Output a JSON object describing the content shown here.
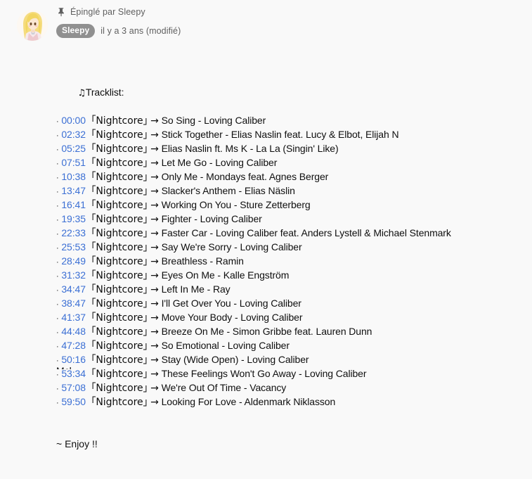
{
  "comment": {
    "pinned_label": "Épinglé par Sleepy",
    "pin_icon": "pin-icon",
    "author_name": "Sleepy",
    "timestamp": "il y a 3 ans (modifié)",
    "avatar_alt": "anime-girl-avatar",
    "heading": "♫ Tracklist:",
    "heading_note": "♫",
    "heading_text": "Tracklist:",
    "bullet": "·",
    "bracket_open": "｢",
    "bracket_close": "｣",
    "bracket_label": "Nightcore",
    "arrow": "→",
    "footer": "~ Enjoy !!",
    "footer_clipped": "Mcl"
  },
  "tracklist": [
    {
      "time": "00:00",
      "title": "So Sing - Loving Caliber"
    },
    {
      "time": "02:32",
      "title": "Stick Together - Elias Naslin feat. Lucy & Elbot, Elijah N"
    },
    {
      "time": "05:25",
      "title": "Elias Naslin ft. Ms K - La La (Singin' Like)"
    },
    {
      "time": "07:51",
      "title": "Let Me Go - Loving Caliber"
    },
    {
      "time": "10:38",
      "title": "Only Me - Mondays feat. Agnes Berger"
    },
    {
      "time": "13:47",
      "title": "Slacker's Anthem - Elias Näslin"
    },
    {
      "time": "16:41",
      "title": "Working On You - Sture Zetterberg"
    },
    {
      "time": "19:35",
      "title": "Fighter - Loving Caliber"
    },
    {
      "time": "22:33",
      "title": "Faster Car - Loving Caliber feat. Anders Lystell & Michael Stenmark"
    },
    {
      "time": "25:53",
      "title": "Say We're Sorry - Loving Caliber"
    },
    {
      "time": "28:49",
      "title": "Breathless - Ramin"
    },
    {
      "time": "31:32",
      "title": "Eyes On Me - Kalle Engström"
    },
    {
      "time": "34:47",
      "title": "Left In Me - Ray"
    },
    {
      "time": "38:47",
      "title": "I'll Get Over You - Loving Caliber"
    },
    {
      "time": "41:37",
      "title": "Move Your Body - Loving Caliber"
    },
    {
      "time": "44:48",
      "title": "Breeze On Me - Simon Gribbe feat. Lauren Dunn"
    },
    {
      "time": "47:28",
      "title": "So Emotional - Loving Caliber"
    },
    {
      "time": "50:16",
      "title": "Stay (Wide Open) - Loving Caliber"
    },
    {
      "time": "53:34",
      "title": "These Feelings Won't Go Away - Loving Caliber"
    },
    {
      "time": "57:08",
      "title": "We're Out Of Time - Vacancy"
    },
    {
      "time": "59:50",
      "title": "Looking For Love - Aldenmark Niklasson"
    }
  ],
  "colors": {
    "background": "#f9f9f9",
    "text": "#0f0f0f",
    "secondary_text": "#606060",
    "link": "#3b6fd4",
    "author_chip_bg": "#909090",
    "author_chip_text": "#ffffff"
  }
}
